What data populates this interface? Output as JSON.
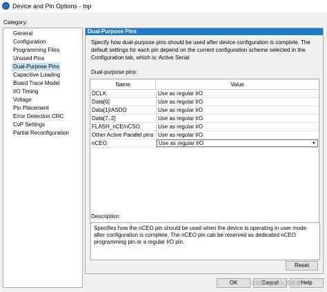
{
  "window": {
    "title": "Device and Pin Options - top"
  },
  "category": {
    "label": "Category:",
    "items": [
      "General",
      "Configuration",
      "Programming Files",
      "Unused Pins",
      "Dual-Purpose Pins",
      "Capacitive Loading",
      "Board Trace Model",
      "I/O Timing",
      "Voltage",
      "Pin Placement",
      "Error Detection CRC",
      "CvP Settings",
      "Partial Reconfiguration"
    ],
    "selected": "Dual-Purpose Pins"
  },
  "panel": {
    "header": "Dual-Purpose Pins",
    "description": "Specify how dual-purpose pins should be used after device configuration is complete. The default settings for each pin depend on the current configuration scheme selected in the Configuration tab, which is:  Active Serial"
  },
  "dual_purpose": {
    "label": "Dual-purpose pins:",
    "columns": [
      "Name",
      "Value"
    ],
    "rows": [
      {
        "name": "DCLK",
        "value": "Use as regular I/O"
      },
      {
        "name": "Data[0]",
        "value": "Use as regular I/O"
      },
      {
        "name": "Data[1]/ASDO",
        "value": "Use as regular I/O"
      },
      {
        "name": "Data[7..2]",
        "value": "Use as regular I/O"
      },
      {
        "name": "FLASH_nCE/nCSO",
        "value": "Use as regular I/O"
      },
      {
        "name": "Other Active Parallel pins",
        "value": "Use as regular I/O"
      },
      {
        "name": "nCEO",
        "value": "Use as regular I/O"
      }
    ]
  },
  "description_box": {
    "label": "Description:",
    "text": "Specifies how the nCEO pin should be used when the device is operating in user mode after configuration is complete. The nCEO pin can be reserved as dedicated nCEO programming pin or a regular I/O pin."
  },
  "buttons": {
    "reset": "Reset",
    "ok": "OK",
    "cancel": "Cancel",
    "help": "Help"
  },
  "watermark": "CSDN @嵌入式老夜"
}
